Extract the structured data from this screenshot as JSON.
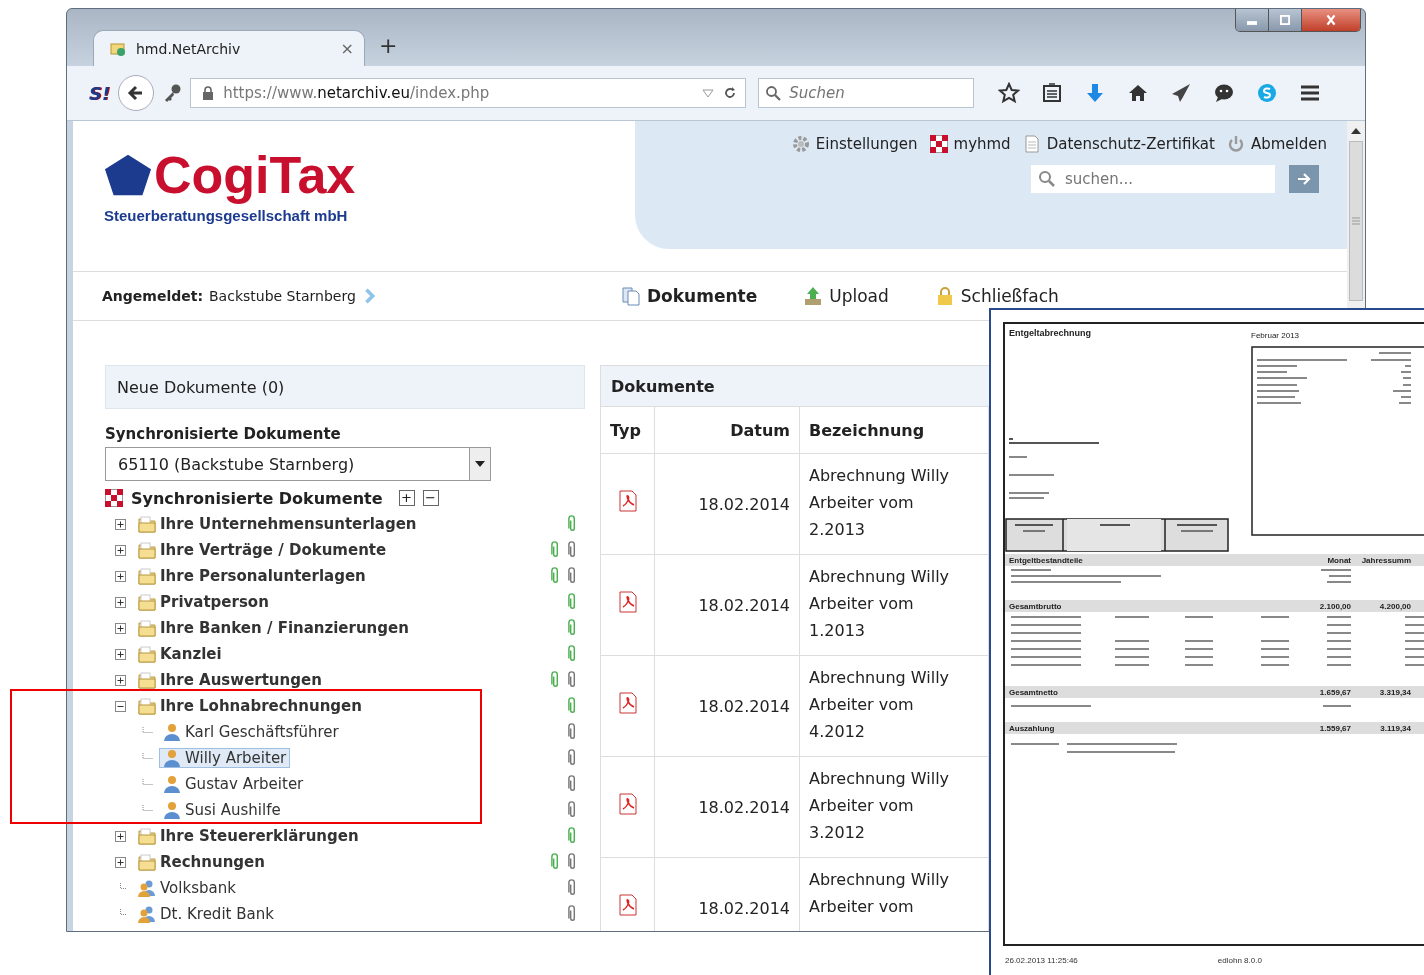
{
  "browser": {
    "tab_title": "hmd.NetArchiv",
    "tab_close": "×",
    "new_tab": "+",
    "addon_logo": "S!",
    "url_prefix": "https://www.",
    "url_domain": "netarchiv.eu",
    "url_path": "/index.php",
    "search_placeholder": "Suchen"
  },
  "header": {
    "logo_text": "CogiTax",
    "logo_subtitle": "Steuerberatungsgesellschaft mbH",
    "links": [
      {
        "kind": "gear",
        "label": "Einstellungen"
      },
      {
        "kind": "grid",
        "label": "myhmd"
      },
      {
        "kind": "page",
        "label": "Datenschutz-Zertifikat"
      },
      {
        "kind": "power",
        "label": "Abmelden"
      }
    ],
    "search_placeholder": "suchen..."
  },
  "user_bar": {
    "label": "Angemeldet:",
    "user": "Backstube Starnberg"
  },
  "nav": [
    {
      "kind": "docs",
      "label": "Dokumente",
      "selected": true
    },
    {
      "kind": "upload",
      "label": "Upload",
      "selected": false
    },
    {
      "kind": "lock",
      "label": "Schließfach",
      "selected": false
    }
  ],
  "new_documents": "Neue Dokumente (0)",
  "sync_heading": "Synchronisierte Dokumente",
  "client_select": "65110 (Backstube Starnberg)",
  "tree": {
    "title": "Synchronisierte Dokumente",
    "expand_all": "+",
    "collapse_all": "−",
    "items": [
      {
        "kind": "folder",
        "label": "Ihre Unternehmensunterlagen",
        "expanded": false,
        "attachments": [
          {
            "color": "#4caf50"
          }
        ]
      },
      {
        "kind": "folder",
        "label": "Ihre Verträge / Dokumente",
        "expanded": false,
        "attachments": [
          {
            "color": "#4caf50"
          },
          {
            "color": "#777777"
          }
        ]
      },
      {
        "kind": "folder",
        "label": "Ihre Personalunterlagen",
        "expanded": false,
        "attachments": [
          {
            "color": "#4caf50"
          },
          {
            "color": "#777777"
          }
        ]
      },
      {
        "kind": "folder",
        "label": "Privatperson",
        "expanded": false,
        "attachments": [
          {
            "color": "#4caf50"
          }
        ]
      },
      {
        "kind": "folder",
        "label": "Ihre Banken / Finanzierungen",
        "expanded": false,
        "attachments": [
          {
            "color": "#4caf50"
          }
        ]
      },
      {
        "kind": "folder",
        "label": "Kanzlei",
        "expanded": false,
        "attachments": [
          {
            "color": "#4caf50"
          }
        ]
      },
      {
        "kind": "folder",
        "label": "Ihre Auswertungen",
        "expanded": false,
        "attachments": [
          {
            "color": "#4caf50"
          },
          {
            "color": "#777777"
          }
        ]
      },
      {
        "kind": "folder",
        "label": "Ihre Lohnabrechnungen",
        "expanded": true,
        "attachments": [
          {
            "color": "#4caf50"
          }
        ],
        "children": [
          {
            "kind": "person",
            "label": "Karl Geschäftsführer",
            "selected": false,
            "attachments": [
              {
                "color": "#777777"
              }
            ]
          },
          {
            "kind": "person",
            "label": "Willy Arbeiter",
            "selected": true,
            "attachments": [
              {
                "color": "#777777"
              }
            ]
          },
          {
            "kind": "person",
            "label": "Gustav Arbeiter",
            "selected": false,
            "attachments": [
              {
                "color": "#777777"
              }
            ]
          },
          {
            "kind": "person",
            "label": "Susi Aushilfe",
            "selected": false,
            "attachments": [
              {
                "color": "#777777"
              }
            ]
          }
        ]
      },
      {
        "kind": "folder",
        "label": "Ihre Steuererklärungen",
        "expanded": false,
        "attachments": [
          {
            "color": "#4caf50"
          }
        ]
      },
      {
        "kind": "folder",
        "label": "Rechnungen",
        "expanded": false,
        "attachments": [
          {
            "color": "#4caf50"
          },
          {
            "color": "#777777"
          }
        ]
      },
      {
        "kind": "contact",
        "label": "Volksbank",
        "attachments": [
          {
            "color": "#777777"
          }
        ]
      },
      {
        "kind": "contact",
        "label": "Dt. Kredit Bank",
        "attachments": [
          {
            "color": "#777777"
          }
        ]
      }
    ]
  },
  "documents": {
    "title": "Dokumente",
    "columns": [
      "Typ",
      "Datum",
      "Bezeichnung"
    ],
    "rows": [
      {
        "date": "18.02.2014",
        "description": "Abrechnung Willy Arbeiter vom 2.2013"
      },
      {
        "date": "18.02.2014",
        "description": "Abrechnung Willy Arbeiter vom 1.2013"
      },
      {
        "date": "18.02.2014",
        "description": "Abrechnung Willy Arbeiter vom 4.2012"
      },
      {
        "date": "18.02.2014",
        "description": "Abrechnung Willy Arbeiter vom 3.2012"
      },
      {
        "date": "18.02.2014",
        "description": "Abrechnung Willy Arbeiter vom"
      }
    ]
  },
  "payslip": {
    "title": "Entgeltabrechnung",
    "period": "Februar 2013",
    "bars": [
      {
        "label": "Entgeltbestandteile",
        "month": "Monat",
        "year": "Jahressumm"
      },
      {
        "label": "Gesamtbrutto",
        "month": "2.100,00",
        "year": "4.200,00"
      },
      {
        "label": "Gesamtnetto",
        "month": "1.659,67",
        "year": "3.319,34"
      },
      {
        "label": "Auszahlung",
        "month": "1.559,67",
        "year": "3.119,34"
      }
    ],
    "footer_date": "26.02.2013 11:25:46",
    "footer_program": "edlohn 8.0.0"
  }
}
